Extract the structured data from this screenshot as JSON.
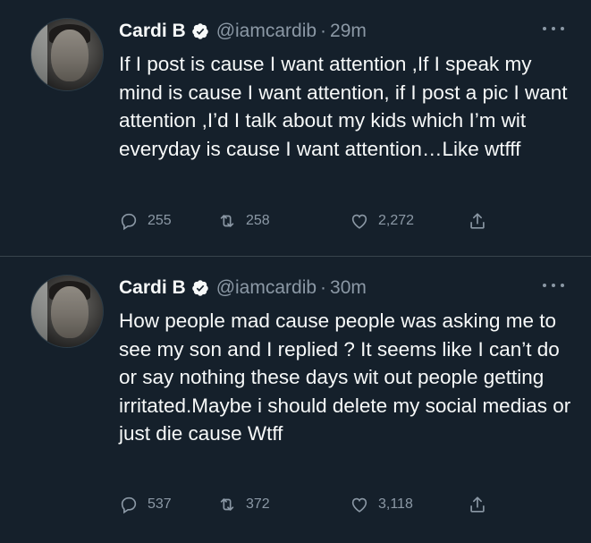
{
  "tweets": [
    {
      "author": "Cardi B",
      "handle": "@iamcardib",
      "separator": "·",
      "time": "29m",
      "text": "If I post is cause I want attention ,If I speak my mind is cause I want attention, if I post a pic I want attention ,I’d I talk about my kids which I’m wit everyday is cause I want attention…Like wtfff",
      "replies": "255",
      "retweets": "258",
      "likes": "2,272"
    },
    {
      "author": "Cardi B",
      "handle": "@iamcardib",
      "separator": "·",
      "time": "30m",
      "text": "How people mad cause people was asking me to see my son and I replied ? It seems like I can’t do or say nothing these days wit out people getting irritated.Maybe i should delete my social medias or just die cause Wtff",
      "replies": "537",
      "retweets": "372",
      "likes": "3,118"
    }
  ],
  "icons": {
    "verified": "verified-badge-icon",
    "more": "more-icon",
    "reply": "reply-icon",
    "retweet": "retweet-icon",
    "like": "like-icon",
    "share": "share-icon"
  },
  "colors": {
    "background": "#15202b",
    "text": "#f7f9f9",
    "secondary": "#8b98a5",
    "divider": "#38444d"
  }
}
